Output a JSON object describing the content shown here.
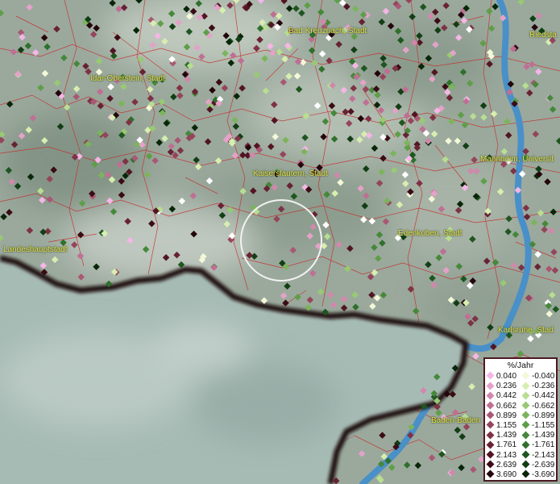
{
  "map": {
    "colors": {
      "land": "#9ba99d",
      "lake": "#a7bbb5",
      "water": "#4a90c8",
      "borders": "#c8282a",
      "boundary": "#1c0808",
      "labels": "#e8e64a"
    }
  },
  "cities": [
    {
      "name": "Bad Kreuznach, Stadt"
    },
    {
      "name": "Idar-Oberstein, Stadt"
    },
    {
      "name": "Kaiserslautern, Stadt"
    },
    {
      "name": "Mannheim, Universit"
    },
    {
      "name": "Landeshauptstadt"
    },
    {
      "name": "Edenkoben, Stadt"
    },
    {
      "name": "Karlsruhe, Stad"
    },
    {
      "name": "Baden-Baden"
    },
    {
      "name": "Riedsta"
    }
  ],
  "legend": {
    "title": "%/Jahr",
    "positive": [
      {
        "value": "0.040",
        "color": "#f4b6e6"
      },
      {
        "value": "0.236",
        "color": "#e4a2c8"
      },
      {
        "value": "0.442",
        "color": "#d088ac"
      },
      {
        "value": "0.662",
        "color": "#bf6f94"
      },
      {
        "value": "0.899",
        "color": "#a85874"
      },
      {
        "value": "1.155",
        "color": "#94455c"
      },
      {
        "value": "1.439",
        "color": "#7e3246"
      },
      {
        "value": "1.761",
        "color": "#682234"
      },
      {
        "value": "2.143",
        "color": "#521523"
      },
      {
        "value": "2.639",
        "color": "#3a0c16"
      },
      {
        "value": "3.690",
        "color": "#24050b"
      }
    ],
    "negative": [
      {
        "value": "-0.040",
        "color": "#f4f8d8"
      },
      {
        "value": "-0.236",
        "color": "#d8eeb0"
      },
      {
        "value": "-0.442",
        "color": "#b8de90"
      },
      {
        "value": "-0.662",
        "color": "#98ca72"
      },
      {
        "value": "-0.899",
        "color": "#7cb45c"
      },
      {
        "value": "-1.155",
        "color": "#5e9e48"
      },
      {
        "value": "-1.439",
        "color": "#46883a"
      },
      {
        "value": "-1.761",
        "color": "#30702c"
      },
      {
        "value": "-2.143",
        "color": "#1e5620"
      },
      {
        "value": "-2.639",
        "color": "#123e14"
      },
      {
        "value": "-3.690",
        "color": "#082608"
      }
    ]
  }
}
